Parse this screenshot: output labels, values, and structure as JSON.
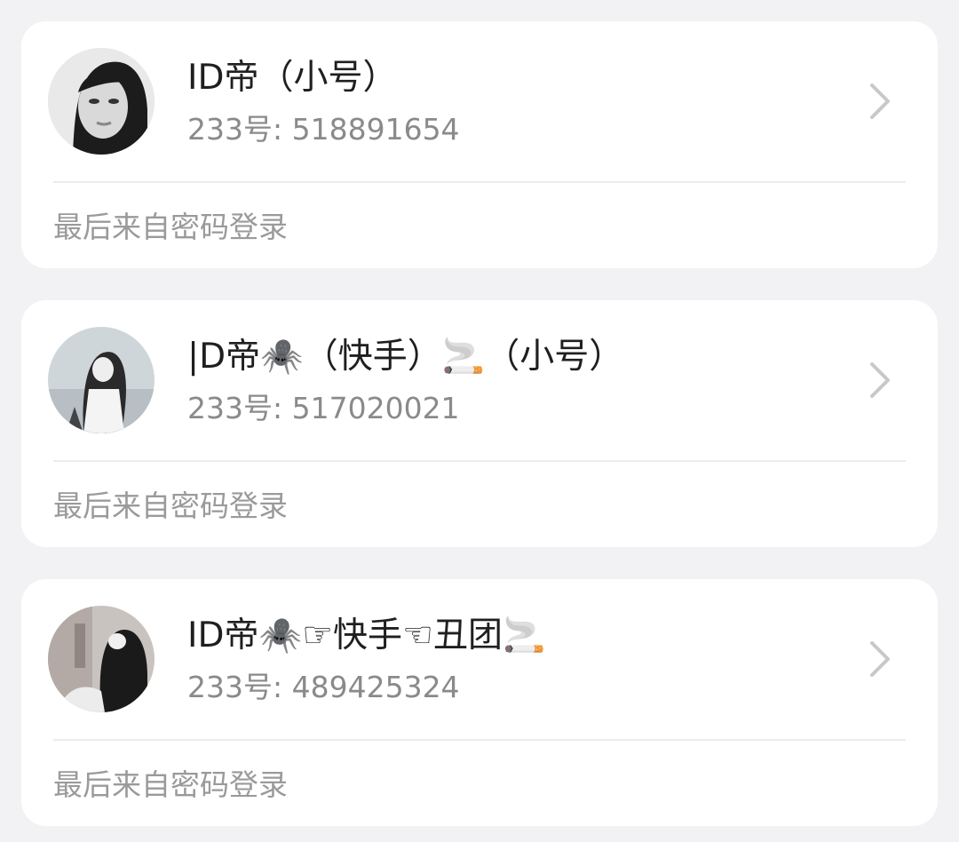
{
  "accounts": [
    {
      "name": "ID帝（小号）",
      "account_id": "233号: 518891654",
      "login_note": "最后来自密码登录",
      "avatar": "avatar-photo"
    },
    {
      "name": "|D帝🕷️（快手）🚬（小号）",
      "account_id": "233号: 517020021",
      "login_note": "最后来自密码登录",
      "avatar": "avatar-photo"
    },
    {
      "name": "ID帝🕷️☞快手☜丑团🚬",
      "account_id": "233号: 489425324",
      "login_note": "最后来自密码登录",
      "avatar": "avatar-photo"
    }
  ],
  "icons": {
    "chevron": "chevron-right-icon"
  },
  "colors": {
    "background": "#f2f2f4",
    "card": "#ffffff",
    "name_text": "#1f1f1f",
    "secondary_text": "#8a8a8a"
  }
}
